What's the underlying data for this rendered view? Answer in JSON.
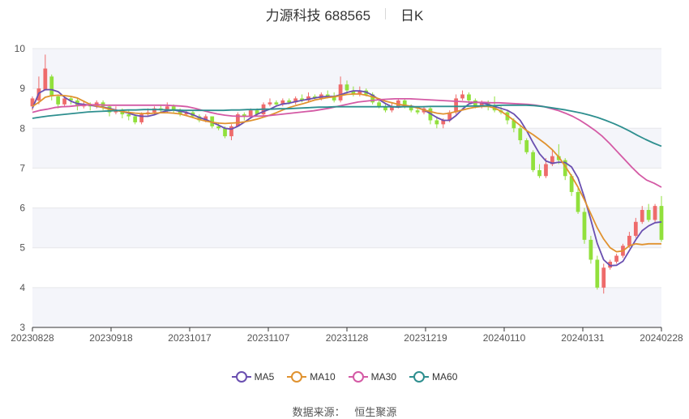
{
  "header": {
    "title": "力源科技 688565",
    "period": "日K"
  },
  "source": {
    "label": "数据来源：",
    "name": "恒生聚源"
  },
  "colors": {
    "up": "#ee6b6b",
    "down": "#91e03c",
    "MA5": "#6a4fb0",
    "MA10": "#e0922f",
    "MA30": "#d45aa5",
    "MA60": "#2e8f8f"
  },
  "chart_data": {
    "type": "candlestick",
    "title": "力源科技 688565",
    "subtitle": "日K",
    "ylim": [
      3,
      10
    ],
    "yticks": [
      3,
      4,
      5,
      6,
      7,
      8,
      9,
      10
    ],
    "xtick_labels": [
      "20230828",
      "20230918",
      "20231017",
      "20231107",
      "20231128",
      "20231219",
      "20240110",
      "20240131",
      "20240228"
    ],
    "legend": [
      "MA5",
      "MA10",
      "MA30",
      "MA60"
    ],
    "candles": [
      [
        8.55,
        8.75,
        8.45,
        8.8
      ],
      [
        8.7,
        9.0,
        8.6,
        9.3
      ],
      [
        8.95,
        9.5,
        9.1,
        9.85
      ],
      [
        9.3,
        8.8,
        8.7,
        9.35
      ],
      [
        8.8,
        8.6,
        8.5,
        8.85
      ],
      [
        8.6,
        8.75,
        8.55,
        8.8
      ],
      [
        8.75,
        8.7,
        8.6,
        8.8
      ],
      [
        8.7,
        8.55,
        8.45,
        8.75
      ],
      [
        8.55,
        8.6,
        8.5,
        8.7
      ],
      [
        8.6,
        8.55,
        8.45,
        8.65
      ],
      [
        8.55,
        8.65,
        8.5,
        8.7
      ],
      [
        8.65,
        8.55,
        8.45,
        8.7
      ],
      [
        8.55,
        8.4,
        8.3,
        8.6
      ],
      [
        8.4,
        8.45,
        8.35,
        8.55
      ],
      [
        8.45,
        8.35,
        8.25,
        8.5
      ],
      [
        8.35,
        8.3,
        8.2,
        8.45
      ],
      [
        8.3,
        8.15,
        8.1,
        8.35
      ],
      [
        8.15,
        8.35,
        8.1,
        8.4
      ],
      [
        8.35,
        8.4,
        8.3,
        8.5
      ],
      [
        8.4,
        8.5,
        8.35,
        8.55
      ],
      [
        8.5,
        8.45,
        8.4,
        8.6
      ],
      [
        8.45,
        8.55,
        8.4,
        8.65
      ],
      [
        8.55,
        8.45,
        8.4,
        8.6
      ],
      [
        8.45,
        8.35,
        8.3,
        8.5
      ],
      [
        8.35,
        8.4,
        8.3,
        8.45
      ],
      [
        8.4,
        8.3,
        8.25,
        8.45
      ],
      [
        8.3,
        8.2,
        8.15,
        8.35
      ],
      [
        8.2,
        8.3,
        8.15,
        8.35
      ],
      [
        8.3,
        8.05,
        8.0,
        8.3
      ],
      [
        8.05,
        8.0,
        7.95,
        8.15
      ],
      [
        8.0,
        7.8,
        7.75,
        8.05
      ],
      [
        7.8,
        8.05,
        7.7,
        8.1
      ],
      [
        8.05,
        8.35,
        8.05,
        8.4
      ],
      [
        8.35,
        8.3,
        8.2,
        8.4
      ],
      [
        8.3,
        8.45,
        8.25,
        8.5
      ],
      [
        8.45,
        8.35,
        8.3,
        8.5
      ],
      [
        8.35,
        8.6,
        8.3,
        8.65
      ],
      [
        8.6,
        8.65,
        8.55,
        8.75
      ],
      [
        8.65,
        8.6,
        8.55,
        8.7
      ],
      [
        8.6,
        8.7,
        8.55,
        8.75
      ],
      [
        8.7,
        8.65,
        8.6,
        8.75
      ],
      [
        8.65,
        8.75,
        8.6,
        8.8
      ],
      [
        8.75,
        8.7,
        8.65,
        8.85
      ],
      [
        8.7,
        8.8,
        8.65,
        8.9
      ],
      [
        8.8,
        8.75,
        8.7,
        8.85
      ],
      [
        8.75,
        8.85,
        8.7,
        8.9
      ],
      [
        8.85,
        8.8,
        8.75,
        8.95
      ],
      [
        8.8,
        8.7,
        8.65,
        8.9
      ],
      [
        8.7,
        9.1,
        8.65,
        9.3
      ],
      [
        9.1,
        8.95,
        8.85,
        9.2
      ],
      [
        8.95,
        8.85,
        8.8,
        9.05
      ],
      [
        8.85,
        8.95,
        8.8,
        9.05
      ],
      [
        8.95,
        8.85,
        8.8,
        9.0
      ],
      [
        8.85,
        8.65,
        8.6,
        8.9
      ],
      [
        8.65,
        8.55,
        8.5,
        8.75
      ],
      [
        8.55,
        8.45,
        8.4,
        8.6
      ],
      [
        8.45,
        8.55,
        8.4,
        8.65
      ],
      [
        8.55,
        8.7,
        8.5,
        8.75
      ],
      [
        8.7,
        8.55,
        8.5,
        8.75
      ],
      [
        8.55,
        8.45,
        8.4,
        8.6
      ],
      [
        8.45,
        8.4,
        8.35,
        8.55
      ],
      [
        8.4,
        8.5,
        8.35,
        8.55
      ],
      [
        8.5,
        8.2,
        8.1,
        8.55
      ],
      [
        8.2,
        8.1,
        8.0,
        8.3
      ],
      [
        8.1,
        8.2,
        8.0,
        8.25
      ],
      [
        8.2,
        8.4,
        8.15,
        8.45
      ],
      [
        8.4,
        8.75,
        8.35,
        8.85
      ],
      [
        8.75,
        8.85,
        8.7,
        8.95
      ],
      [
        8.85,
        8.7,
        8.6,
        8.9
      ],
      [
        8.7,
        8.55,
        8.5,
        8.75
      ],
      [
        8.55,
        8.65,
        8.5,
        8.7
      ],
      [
        8.65,
        8.55,
        8.45,
        8.7
      ],
      [
        8.55,
        8.45,
        8.4,
        8.8
      ],
      [
        8.45,
        8.4,
        8.35,
        8.55
      ],
      [
        8.4,
        8.2,
        8.1,
        8.45
      ],
      [
        8.2,
        8.0,
        7.9,
        8.25
      ],
      [
        8.0,
        7.7,
        7.6,
        8.05
      ],
      [
        7.7,
        7.4,
        7.35,
        7.75
      ],
      [
        7.4,
        6.95,
        6.9,
        7.45
      ],
      [
        6.95,
        6.8,
        6.75,
        7.1
      ],
      [
        6.8,
        7.1,
        6.75,
        7.25
      ],
      [
        7.1,
        7.3,
        7.05,
        7.45
      ],
      [
        7.3,
        7.2,
        7.1,
        7.6
      ],
      [
        7.2,
        6.8,
        6.7,
        7.25
      ],
      [
        6.8,
        6.4,
        6.3,
        6.85
      ],
      [
        6.4,
        5.9,
        5.85,
        6.5
      ],
      [
        5.9,
        5.2,
        5.1,
        6.0
      ],
      [
        5.2,
        4.7,
        4.6,
        5.3
      ],
      [
        4.7,
        4.0,
        3.95,
        4.8
      ],
      [
        4.0,
        4.5,
        3.85,
        4.6
      ],
      [
        4.5,
        4.65,
        4.45,
        4.7
      ],
      [
        4.65,
        4.8,
        4.6,
        4.85
      ],
      [
        4.8,
        5.05,
        4.75,
        5.1
      ],
      [
        5.05,
        5.3,
        5.0,
        5.4
      ],
      [
        5.3,
        5.65,
        5.25,
        5.75
      ],
      [
        5.65,
        5.95,
        5.6,
        6.05
      ],
      [
        5.95,
        5.7,
        5.65,
        6.1
      ],
      [
        5.7,
        6.05,
        5.65,
        6.1
      ],
      [
        6.05,
        5.2,
        5.15,
        6.3
      ]
    ],
    "series": [
      {
        "name": "MA5",
        "values": [
          8.5,
          8.88,
          8.97,
          8.97,
          8.92,
          8.78,
          8.68,
          8.62,
          8.6,
          8.58,
          8.55,
          8.53,
          8.5,
          8.46,
          8.42,
          8.38,
          8.33,
          8.3,
          8.3,
          8.34,
          8.4,
          8.44,
          8.46,
          8.43,
          8.4,
          8.34,
          8.27,
          8.22,
          8.15,
          8.08,
          8.0,
          7.98,
          8.05,
          8.15,
          8.26,
          8.35,
          8.42,
          8.48,
          8.56,
          8.61,
          8.63,
          8.67,
          8.7,
          8.73,
          8.76,
          8.79,
          8.8,
          8.8,
          8.84,
          8.9,
          8.94,
          8.94,
          8.91,
          8.83,
          8.72,
          8.62,
          8.54,
          8.53,
          8.55,
          8.56,
          8.52,
          8.46,
          8.37,
          8.27,
          8.2,
          8.2,
          8.32,
          8.48,
          8.61,
          8.66,
          8.64,
          8.6,
          8.55,
          8.5,
          8.45,
          8.36,
          8.2,
          7.94,
          7.64,
          7.36,
          7.18,
          7.12,
          7.15,
          7.14,
          7.03,
          6.75,
          6.26,
          5.7,
          5.11,
          4.7,
          4.55,
          4.56,
          4.66,
          4.93,
          5.2,
          5.43,
          5.55,
          5.63,
          5.65
        ]
      },
      {
        "name": "MA10",
        "values": [
          8.55,
          8.65,
          8.78,
          8.82,
          8.83,
          8.82,
          8.8,
          8.76,
          8.68,
          8.6,
          8.56,
          8.52,
          8.48,
          8.45,
          8.42,
          8.4,
          8.38,
          8.37,
          8.37,
          8.38,
          8.39,
          8.39,
          8.38,
          8.36,
          8.32,
          8.27,
          8.22,
          8.18,
          8.15,
          8.13,
          8.12,
          8.13,
          8.14,
          8.16,
          8.19,
          8.23,
          8.28,
          8.33,
          8.39,
          8.46,
          8.52,
          8.57,
          8.61,
          8.66,
          8.71,
          8.74,
          8.77,
          8.79,
          8.82,
          8.85,
          8.86,
          8.86,
          8.83,
          8.79,
          8.74,
          8.68,
          8.64,
          8.6,
          8.58,
          8.55,
          8.51,
          8.46,
          8.42,
          8.38,
          8.36,
          8.38,
          8.42,
          8.46,
          8.5,
          8.53,
          8.55,
          8.55,
          8.51,
          8.43,
          8.32,
          8.2,
          8.07,
          7.94,
          7.84,
          7.72,
          7.6,
          7.46,
          7.28,
          7.05,
          6.8,
          6.52,
          6.2,
          5.85,
          5.5,
          5.22,
          5.0,
          4.9,
          4.92,
          5.05,
          5.1,
          5.08,
          5.1,
          5.1,
          5.1
        ]
      },
      {
        "name": "MA30",
        "values": [
          8.4,
          8.45,
          8.48,
          8.52,
          8.54,
          8.55,
          8.57,
          8.58,
          8.59,
          8.59,
          8.58,
          8.58,
          8.58,
          8.58,
          8.58,
          8.58,
          8.58,
          8.58,
          8.58,
          8.57,
          8.56,
          8.54,
          8.5,
          8.45,
          8.4,
          8.36,
          8.33,
          8.31,
          8.3,
          8.3,
          8.3,
          8.31,
          8.32,
          8.34,
          8.36,
          8.38,
          8.4,
          8.42,
          8.44,
          8.47,
          8.5,
          8.54,
          8.58,
          8.62,
          8.66,
          8.68,
          8.7,
          8.72,
          8.73,
          8.74,
          8.74,
          8.74,
          8.73,
          8.72,
          8.71,
          8.7,
          8.69,
          8.68,
          8.67,
          8.66,
          8.65,
          8.65,
          8.64,
          8.64,
          8.63,
          8.62,
          8.61,
          8.6,
          8.58,
          8.55,
          8.5,
          8.45,
          8.38,
          8.3,
          8.2,
          8.08,
          7.95,
          7.8,
          7.62,
          7.42,
          7.22,
          7.02,
          6.84,
          6.7,
          6.62,
          6.52
        ]
      },
      {
        "name": "MA60",
        "values": [
          8.25,
          8.28,
          8.31,
          8.33,
          8.35,
          8.37,
          8.39,
          8.41,
          8.42,
          8.43,
          8.44,
          8.45,
          8.46,
          8.46,
          8.47,
          8.47,
          8.47,
          8.46,
          8.46,
          8.45,
          8.45,
          8.45,
          8.45,
          8.45,
          8.45,
          8.46,
          8.46,
          8.47,
          8.47,
          8.48,
          8.48,
          8.49,
          8.49,
          8.5,
          8.51,
          8.52,
          8.53,
          8.53,
          8.54,
          8.54,
          8.54,
          8.54,
          8.54,
          8.54,
          8.54,
          8.54,
          8.54,
          8.54,
          8.54,
          8.54,
          8.55,
          8.55,
          8.55,
          8.55,
          8.55,
          8.56,
          8.56,
          8.57,
          8.57,
          8.58,
          8.58,
          8.58,
          8.58,
          8.57,
          8.55,
          8.52,
          8.49,
          8.46,
          8.42,
          8.38,
          8.33,
          8.27,
          8.2,
          8.12,
          8.03,
          7.93,
          7.82,
          7.72,
          7.63,
          7.55
        ]
      }
    ]
  }
}
